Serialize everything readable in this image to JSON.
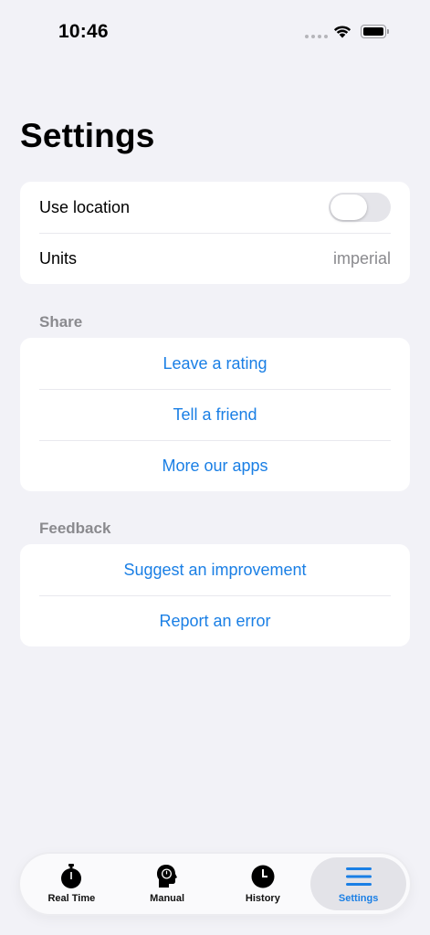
{
  "status_bar": {
    "time": "10:46"
  },
  "page": {
    "title": "Settings"
  },
  "general": {
    "use_location_label": "Use location",
    "use_location_on": false,
    "units_label": "Units",
    "units_value": "imperial"
  },
  "share": {
    "header": "Share",
    "items": [
      {
        "label": "Leave a rating"
      },
      {
        "label": "Tell a friend"
      },
      {
        "label": "More our apps"
      }
    ]
  },
  "feedback": {
    "header": "Feedback",
    "items": [
      {
        "label": "Suggest an improvement"
      },
      {
        "label": "Report an error"
      }
    ]
  },
  "tab_bar": {
    "active": "Settings",
    "tabs": [
      {
        "label": "Real Time",
        "icon": "stopwatch-icon"
      },
      {
        "label": "Manual",
        "icon": "head-stopwatch-icon"
      },
      {
        "label": "History",
        "icon": "clock-icon"
      },
      {
        "label": "Settings",
        "icon": "menu-lines-icon"
      }
    ]
  },
  "colors": {
    "accent": "#1a7fe5",
    "background": "#f2f2f7",
    "secondary_text": "#8a8a8e"
  }
}
